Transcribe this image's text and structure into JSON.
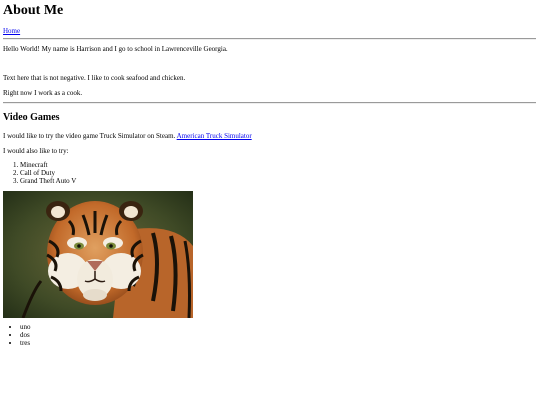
{
  "header": {
    "title": "About Me"
  },
  "nav": {
    "home_label": "Home"
  },
  "intro": {
    "line1": "Hello World! My name is Harrison and I go to school in Lawrenceville Georgia.",
    "line2": "Text here that is not negative. I like to cook seafood and chicken.",
    "line3": "Right now I work as a cook."
  },
  "games": {
    "heading": "Video Games",
    "try_prefix": "I would like to try the video game Truck Simulator on Steam. ",
    "try_link": "American Truck Simulator",
    "also_like": "I would also like to try:",
    "list": [
      "Minecraft",
      "Call of Duty",
      "Grand Theft Auto V"
    ]
  },
  "image": {
    "subject": "tiger"
  },
  "bullets": [
    "uno",
    "dos",
    "tres"
  ]
}
